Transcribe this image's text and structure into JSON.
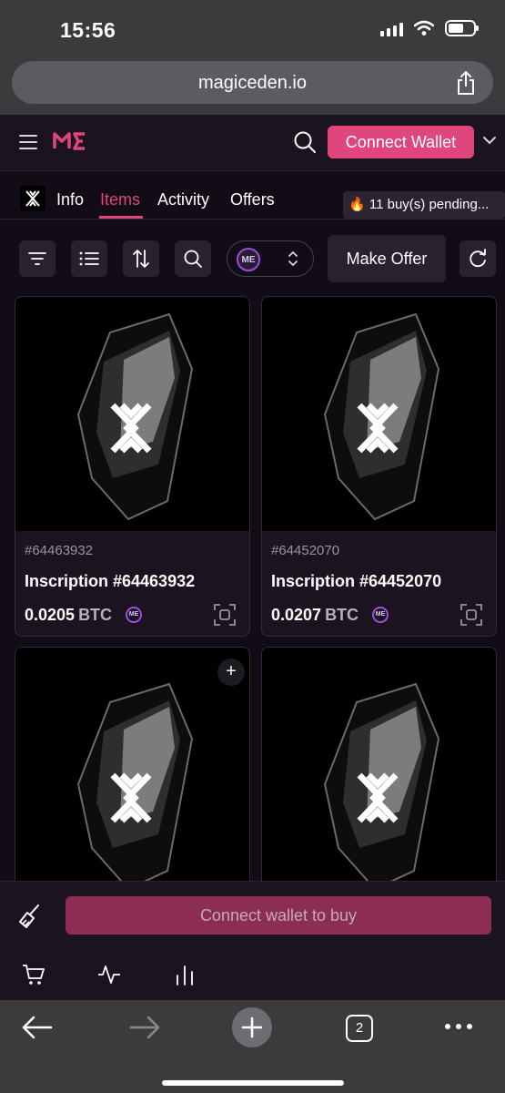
{
  "status_bar": {
    "time": "15:56"
  },
  "browser": {
    "url": "magiceden.io",
    "tab_count": "2"
  },
  "header": {
    "logo_text": "ME",
    "connect_wallet_label": "Connect Wallet"
  },
  "tabs": [
    {
      "label": "Info",
      "active": false
    },
    {
      "label": "Items",
      "active": true
    },
    {
      "label": "Activity",
      "active": false
    },
    {
      "label": "Offers",
      "active": false
    }
  ],
  "pending": {
    "icon": "fire-icon",
    "text": "11 buy(s) pending..."
  },
  "toolbar": {
    "currency_logo": "ME",
    "make_offer_label": "Make Offer"
  },
  "items": [
    {
      "id": "#64463932",
      "title": "Inscription #64463932",
      "price": "0.0205",
      "currency": "BTC"
    },
    {
      "id": "#64452070",
      "title": "Inscription #64452070",
      "price": "0.0207",
      "currency": "BTC"
    }
  ],
  "buy_bar": {
    "label": "Connect wallet to buy"
  },
  "colors": {
    "accent": "#e0457b",
    "background": "#120c16",
    "panel": "#1b1420",
    "purple": "#9e4de0"
  }
}
